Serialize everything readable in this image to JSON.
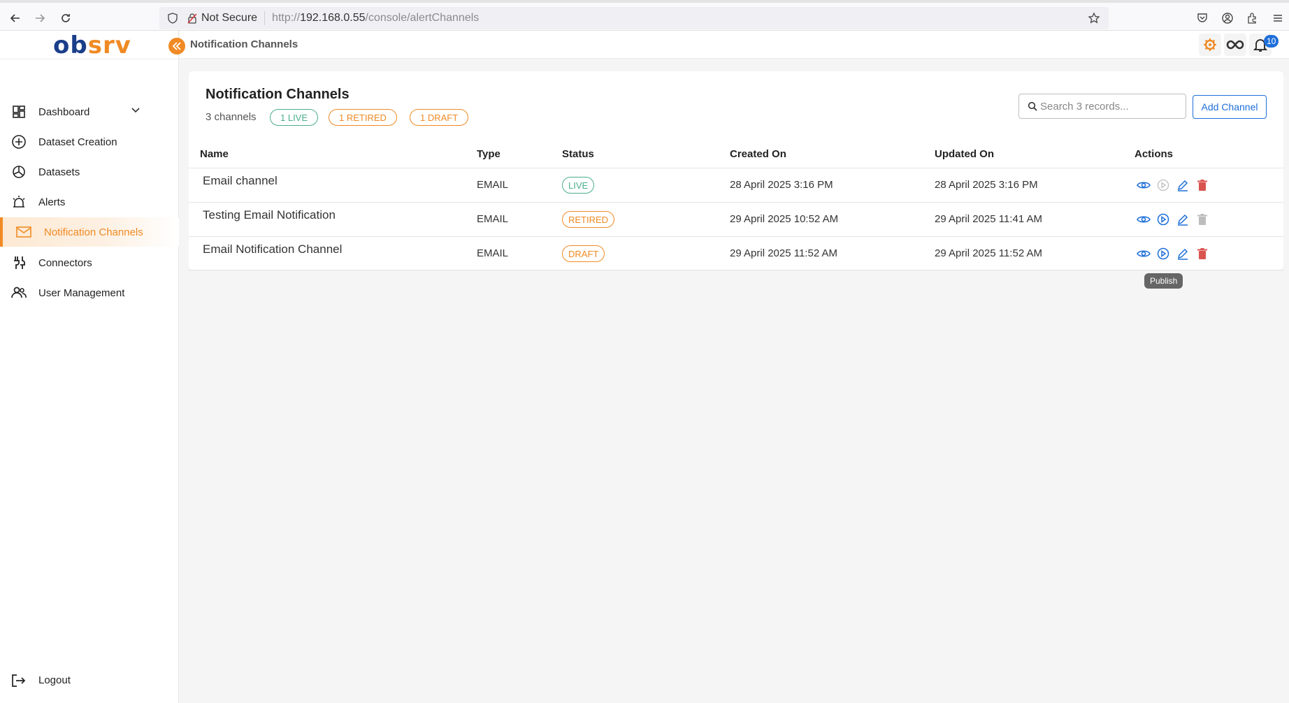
{
  "browser": {
    "not_secure": "Not Secure",
    "url_prefix": "http://",
    "url_host": "192.168.0.55",
    "url_path": "/console/alertChannels"
  },
  "sidebar": {
    "logo_left": "ob",
    "logo_right": "srv",
    "items": [
      {
        "label": "Dashboard",
        "icon": "dashboard-icon"
      },
      {
        "label": "Dataset Creation",
        "icon": "add-circle-icon"
      },
      {
        "label": "Datasets",
        "icon": "datasets-icon"
      },
      {
        "label": "Alerts",
        "icon": "alert-siren-icon"
      },
      {
        "label": "Notification Channels",
        "icon": "mail-icon"
      },
      {
        "label": "Connectors",
        "icon": "connectors-icon"
      },
      {
        "label": "User Management",
        "icon": "users-icon"
      }
    ],
    "logout": "Logout"
  },
  "header": {
    "breadcrumb": "Notification Channels",
    "notification_count": "10"
  },
  "main": {
    "title": "Notification Channels",
    "count": "3 channels",
    "pills": {
      "live": "1 LIVE",
      "retired": "1 RETIRED",
      "draft": "1 DRAFT"
    },
    "search_placeholder": "Search 3 records...",
    "add_button": "Add Channel",
    "columns": [
      "Name",
      "Type",
      "Status",
      "Created On",
      "Updated On",
      "Actions"
    ],
    "rows": [
      {
        "name": "Email channel",
        "type": "EMAIL",
        "status": "LIVE",
        "created": "28 April 2025 3:16 PM",
        "updated": "28 April 2025 3:16 PM"
      },
      {
        "name": "Testing Email Notification",
        "type": "EMAIL",
        "status": "RETIRED",
        "created": "29 April 2025 10:52 AM",
        "updated": "29 April 2025 11:41 AM"
      },
      {
        "name": "Email Notification Channel",
        "type": "EMAIL",
        "status": "DRAFT",
        "created": "29 April 2025 11:52 AM",
        "updated": "29 April 2025 11:52 AM"
      }
    ],
    "tooltip": "Publish"
  },
  "colors": {
    "accent": "#f08a24",
    "primary": "#1e6fd9",
    "live": "#4cae8c",
    "delete": "#d9534f"
  }
}
